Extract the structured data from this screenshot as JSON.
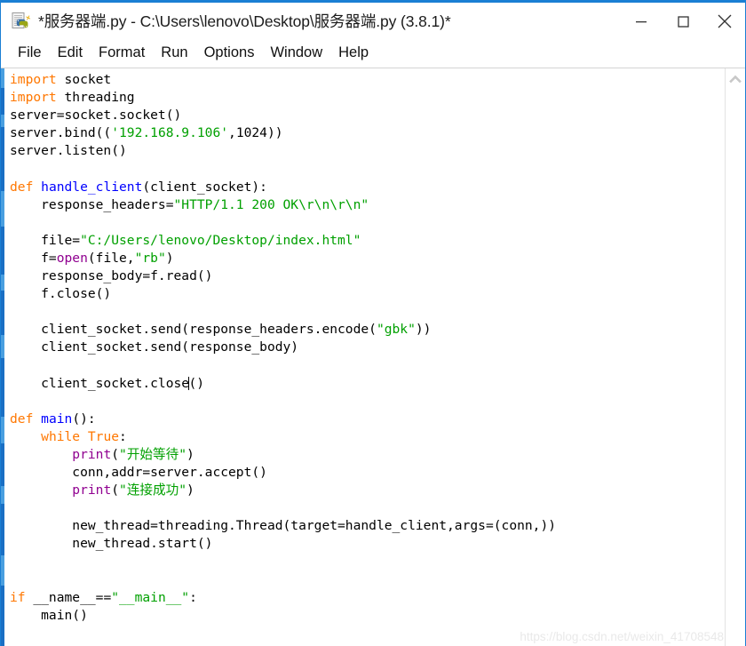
{
  "window": {
    "title": "*服务器端.py - C:\\Users\\lenovo\\Desktop\\服务器端.py (3.8.1)*",
    "icon": "python-file-icon",
    "accent_color": "#1a7fd4",
    "controls": {
      "minimize": "Minimize",
      "maximize": "Maximize",
      "close": "Close"
    }
  },
  "menubar": {
    "items": [
      {
        "label": "File"
      },
      {
        "label": "Edit"
      },
      {
        "label": "Format"
      },
      {
        "label": "Run"
      },
      {
        "label": "Options"
      },
      {
        "label": "Window"
      },
      {
        "label": "Help"
      }
    ]
  },
  "editor": {
    "language": "Python",
    "colors": {
      "keyword": "#ff7700",
      "definition": "#0000ff",
      "string": "#00a000",
      "builtin": "#900090",
      "text": "#000000",
      "background": "#ffffff"
    },
    "caret_line": "client_socket.close()",
    "caret_after": "close",
    "lines": [
      "import socket",
      "import threading",
      "server=socket.socket()",
      "server.bind(('192.168.9.106',1024))",
      "server.listen()",
      "",
      "def handle_client(client_socket):",
      "    response_headers=\"HTTP/1.1 200 OK\\r\\n\\r\\n\"",
      "",
      "    file=\"C:/Users/lenovo/Desktop/index.html\"",
      "    f=open(file,\"rb\")",
      "    response_body=f.read()",
      "    f.close()",
      "",
      "    client_socket.send(response_headers.encode(\"gbk\"))",
      "    client_socket.send(response_body)",
      "",
      "    client_socket.close()",
      "",
      "def main():",
      "    while True:",
      "        print(\"开始等待\")",
      "        conn,addr=server.accept()",
      "        print(\"连接成功\")",
      "",
      "        new_thread=threading.Thread(target=handle_client,args=(conn,))",
      "        new_thread.start()",
      "",
      "",
      "if __name__==\"__main__\":",
      "    main()"
    ]
  },
  "scrollbar": {
    "up_arrow": "chevron-up-icon",
    "position": "right"
  },
  "watermark": {
    "text": "https://blog.csdn.net/weixin_41708548"
  }
}
